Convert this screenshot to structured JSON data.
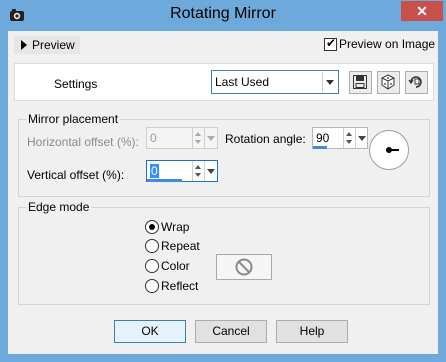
{
  "window": {
    "title": "Rotating Mirror",
    "close_glyph": "✕"
  },
  "toolbar": {
    "preview_toggle_label": "Preview",
    "preview_on_image_label": "Preview on Image",
    "preview_on_image_checked": true
  },
  "settings": {
    "label": "Settings",
    "preset_value": "Last Used",
    "icons": [
      "save-preset-icon",
      "randomize-icon",
      "reset-icon"
    ]
  },
  "mirror_placement": {
    "title": "Mirror placement",
    "horizontal_offset": {
      "label": "Horizontal offset (%):",
      "value": "0",
      "enabled": false
    },
    "vertical_offset": {
      "label": "Vertical offset (%):",
      "value": "0",
      "enabled": true
    },
    "rotation_angle": {
      "label": "Rotation angle:",
      "value": "90"
    }
  },
  "edge_mode": {
    "title": "Edge mode",
    "options": [
      {
        "label": "Wrap",
        "selected": true
      },
      {
        "label": "Repeat",
        "selected": false
      },
      {
        "label": "Color",
        "selected": false
      },
      {
        "label": "Reflect",
        "selected": false
      }
    ]
  },
  "buttons": {
    "ok": "OK",
    "cancel": "Cancel",
    "help": "Help"
  },
  "colors": {
    "accent": "#3f8be0",
    "titlebar": "#6ea9dc",
    "close": "#c7504b"
  }
}
